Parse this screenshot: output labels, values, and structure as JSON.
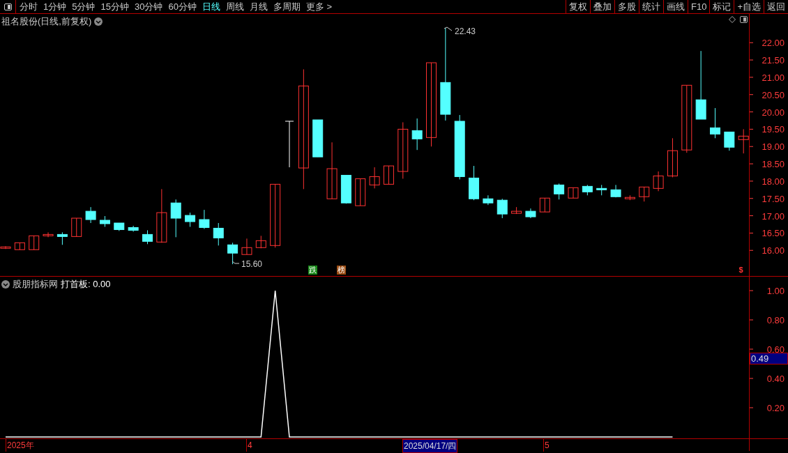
{
  "toolbar": {
    "periods": [
      {
        "label": "分时",
        "selected": false
      },
      {
        "label": "1分钟",
        "selected": false
      },
      {
        "label": "5分钟",
        "selected": false
      },
      {
        "label": "15分钟",
        "selected": false
      },
      {
        "label": "30分钟",
        "selected": false
      },
      {
        "label": "60分钟",
        "selected": false
      },
      {
        "label": "日线",
        "selected": true
      },
      {
        "label": "周线",
        "selected": false
      },
      {
        "label": "月线",
        "selected": false
      },
      {
        "label": "多周期",
        "selected": false
      },
      {
        "label": "更多 >",
        "selected": false
      }
    ],
    "buttons": [
      "复权",
      "叠加",
      "多股",
      "统计",
      "画线",
      "F10",
      "标记",
      "+自选",
      "返回"
    ]
  },
  "price_panel": {
    "title": "祖名股份(日线,前复权)",
    "high_label": "22.43",
    "low_label": "15.60",
    "markers": [
      {
        "kind": "tag",
        "text": "跌",
        "color": "#1a8a1a"
      },
      {
        "kind": "tag",
        "text": "榜",
        "color": "#9a4a10"
      },
      {
        "kind": "sign",
        "text": "$",
        "color": "#ff3232"
      }
    ],
    "chart_data": {
      "type": "candlestick",
      "ylim": [
        15.26,
        22.83
      ],
      "yticks": [
        {
          "value": 22,
          "label": "22.00"
        },
        {
          "value": 21.5,
          "label": "21.50"
        },
        {
          "value": 21,
          "label": "21.00"
        },
        {
          "value": 20.5,
          "label": "20.50"
        },
        {
          "value": 20,
          "label": "20.00"
        },
        {
          "value": 19.5,
          "label": "19.50"
        },
        {
          "value": 19,
          "label": "19.00"
        },
        {
          "value": 18.5,
          "label": "18.50"
        },
        {
          "value": 18,
          "label": "18.00"
        },
        {
          "value": 17.5,
          "label": "17.50"
        },
        {
          "value": 17,
          "label": "17.00"
        },
        {
          "value": 16.5,
          "label": "16.50"
        },
        {
          "value": 16,
          "label": "16.00"
        }
      ],
      "ohlc": [
        [
          16.06,
          16.12,
          16.04,
          16.1
        ],
        [
          16.02,
          16.22,
          16.02,
          16.22
        ],
        [
          16.02,
          16.42,
          16.02,
          16.42
        ],
        [
          16.42,
          16.52,
          16.38,
          16.46
        ],
        [
          16.46,
          16.52,
          16.16,
          16.4
        ],
        [
          16.4,
          16.93,
          16.4,
          16.93
        ],
        [
          17.13,
          17.25,
          16.79,
          16.89
        ],
        [
          16.87,
          16.99,
          16.68,
          16.77
        ],
        [
          16.79,
          16.79,
          16.56,
          16.6
        ],
        [
          16.66,
          16.71,
          16.54,
          16.58
        ],
        [
          16.46,
          16.58,
          16.18,
          16.26
        ],
        [
          16.24,
          17.77,
          16.22,
          17.09
        ],
        [
          17.37,
          17.47,
          16.38,
          16.93
        ],
        [
          17.01,
          17.09,
          16.68,
          16.83
        ],
        [
          16.89,
          17.17,
          16.62,
          16.66
        ],
        [
          16.64,
          16.79,
          16.14,
          16.36
        ],
        [
          16.16,
          16.22,
          15.6,
          15.92
        ],
        [
          15.88,
          16.34,
          15.88,
          16.08
        ],
        [
          16.08,
          16.42,
          16.06,
          16.28
        ],
        [
          16.14,
          17.91,
          16.08,
          17.91
        ],
        [
          19.73,
          19.73,
          18.4,
          19.73
        ],
        [
          18.38,
          21.23,
          17.77,
          20.75
        ],
        [
          19.77,
          19.77,
          18.7,
          18.7
        ],
        [
          17.49,
          19.12,
          17.49,
          18.36
        ],
        [
          18.17,
          18.17,
          17.35,
          17.37
        ],
        [
          17.29,
          18.07,
          17.29,
          18.07
        ],
        [
          17.89,
          18.4,
          17.79,
          18.13
        ],
        [
          17.91,
          18.44,
          17.91,
          18.44
        ],
        [
          18.28,
          19.7,
          18.07,
          19.5
        ],
        [
          19.46,
          19.81,
          18.9,
          19.22
        ],
        [
          19.26,
          21.42,
          19.0,
          21.42
        ],
        [
          20.85,
          22.43,
          19.75,
          19.93
        ],
        [
          19.73,
          19.91,
          18.05,
          18.13
        ],
        [
          18.09,
          18.44,
          17.45,
          17.49
        ],
        [
          17.49,
          17.59,
          17.31,
          17.37
        ],
        [
          17.45,
          17.49,
          16.93,
          17.05
        ],
        [
          17.07,
          17.25,
          17.05,
          17.13
        ],
        [
          17.13,
          17.21,
          16.93,
          16.97
        ],
        [
          17.11,
          17.51,
          17.11,
          17.51
        ],
        [
          17.89,
          17.93,
          17.47,
          17.63
        ],
        [
          17.51,
          17.81,
          17.51,
          17.81
        ],
        [
          17.85,
          17.89,
          17.59,
          17.69
        ],
        [
          17.79,
          17.89,
          17.59,
          17.75
        ],
        [
          17.75,
          17.89,
          17.53,
          17.55
        ],
        [
          17.49,
          17.59,
          17.45,
          17.53
        ],
        [
          17.55,
          17.83,
          17.41,
          17.83
        ],
        [
          17.79,
          18.28,
          17.71,
          18.15
        ],
        [
          18.15,
          19.24,
          18.11,
          18.88
        ],
        [
          18.9,
          20.77,
          18.82,
          20.77
        ],
        [
          20.35,
          21.76,
          19.79,
          19.79
        ],
        [
          19.54,
          20.11,
          19.24,
          19.36
        ],
        [
          19.42,
          19.42,
          18.88,
          18.98
        ],
        [
          19.2,
          19.5,
          18.8,
          19.3
        ]
      ]
    }
  },
  "indicator_panel": {
    "name": "股朋指标网",
    "reading": "打首板: 0.00",
    "current_value": "0.49",
    "chart_data": {
      "type": "line",
      "ylim": [
        0,
        1.1
      ],
      "yticks": [
        {
          "value": 1,
          "label": "1.00"
        },
        {
          "value": 0.8,
          "label": "0.80"
        },
        {
          "value": 0.6,
          "label": "0.60"
        },
        {
          "value": 0.4,
          "label": "0.40"
        },
        {
          "value": 0.2,
          "label": "0.20"
        }
      ],
      "series": [
        {
          "color": "#ffffff",
          "values": [
            0,
            0,
            0,
            0,
            0,
            0,
            0,
            0,
            0,
            0,
            0,
            0,
            0,
            0,
            0,
            0,
            0,
            0,
            0,
            1,
            0,
            0,
            0,
            0,
            0,
            0,
            0,
            0,
            0,
            0,
            0,
            0,
            0,
            0,
            0,
            0,
            0,
            0,
            0,
            0,
            0,
            0,
            0,
            0,
            0,
            0,
            0,
            0,
            null,
            null,
            null,
            null,
            null
          ]
        }
      ]
    }
  },
  "time_axis": [
    {
      "label": "2025年",
      "selected": false
    },
    {
      "label": "4",
      "selected": false
    },
    {
      "label": "2025/04/17/四",
      "selected": true
    },
    {
      "label": "5",
      "selected": false
    }
  ]
}
